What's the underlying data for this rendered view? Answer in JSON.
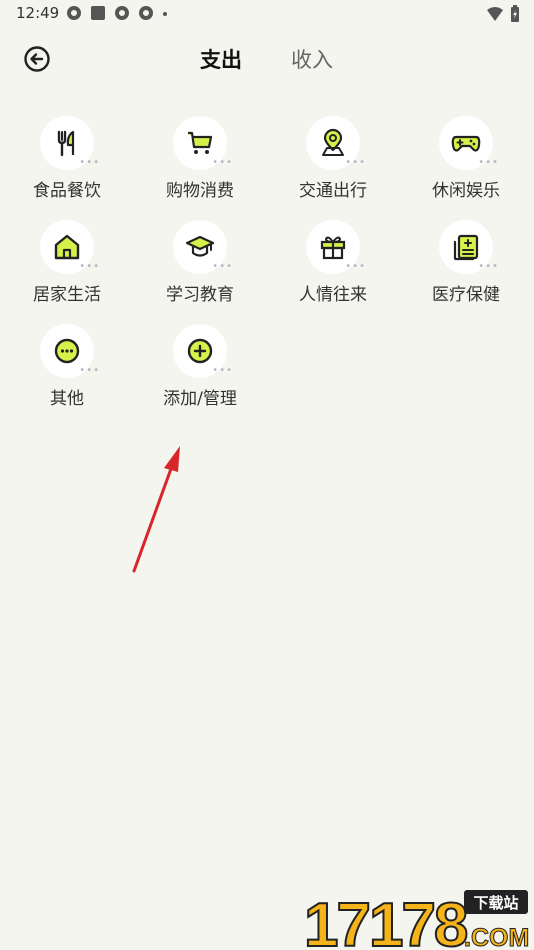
{
  "status_bar": {
    "time": "12:49"
  },
  "header": {
    "back_icon": "back-circle-icon",
    "tabs": [
      {
        "label": "支出",
        "active": true
      },
      {
        "label": "收入",
        "active": false
      }
    ]
  },
  "categories": [
    {
      "label": "食品餐饮",
      "icon": "fork-knife-icon"
    },
    {
      "label": "购物消费",
      "icon": "shopping-cart-icon"
    },
    {
      "label": "交通出行",
      "icon": "location-pin-icon"
    },
    {
      "label": "休闲娱乐",
      "icon": "gamepad-icon"
    },
    {
      "label": "居家生活",
      "icon": "house-icon"
    },
    {
      "label": "学习教育",
      "icon": "graduation-cap-icon"
    },
    {
      "label": "人情往来",
      "icon": "gift-icon"
    },
    {
      "label": "医疗保健",
      "icon": "medical-record-icon"
    },
    {
      "label": "其他",
      "icon": "more-dots-icon"
    },
    {
      "label": "添加/管理",
      "icon": "add-circle-icon"
    }
  ],
  "colors": {
    "accent": "#d6f14a",
    "background": "#f4f5ee",
    "arrow": "#d8262a"
  },
  "watermark": {
    "number": "17178",
    "badge": "下载站",
    "suffix": ".COM"
  }
}
